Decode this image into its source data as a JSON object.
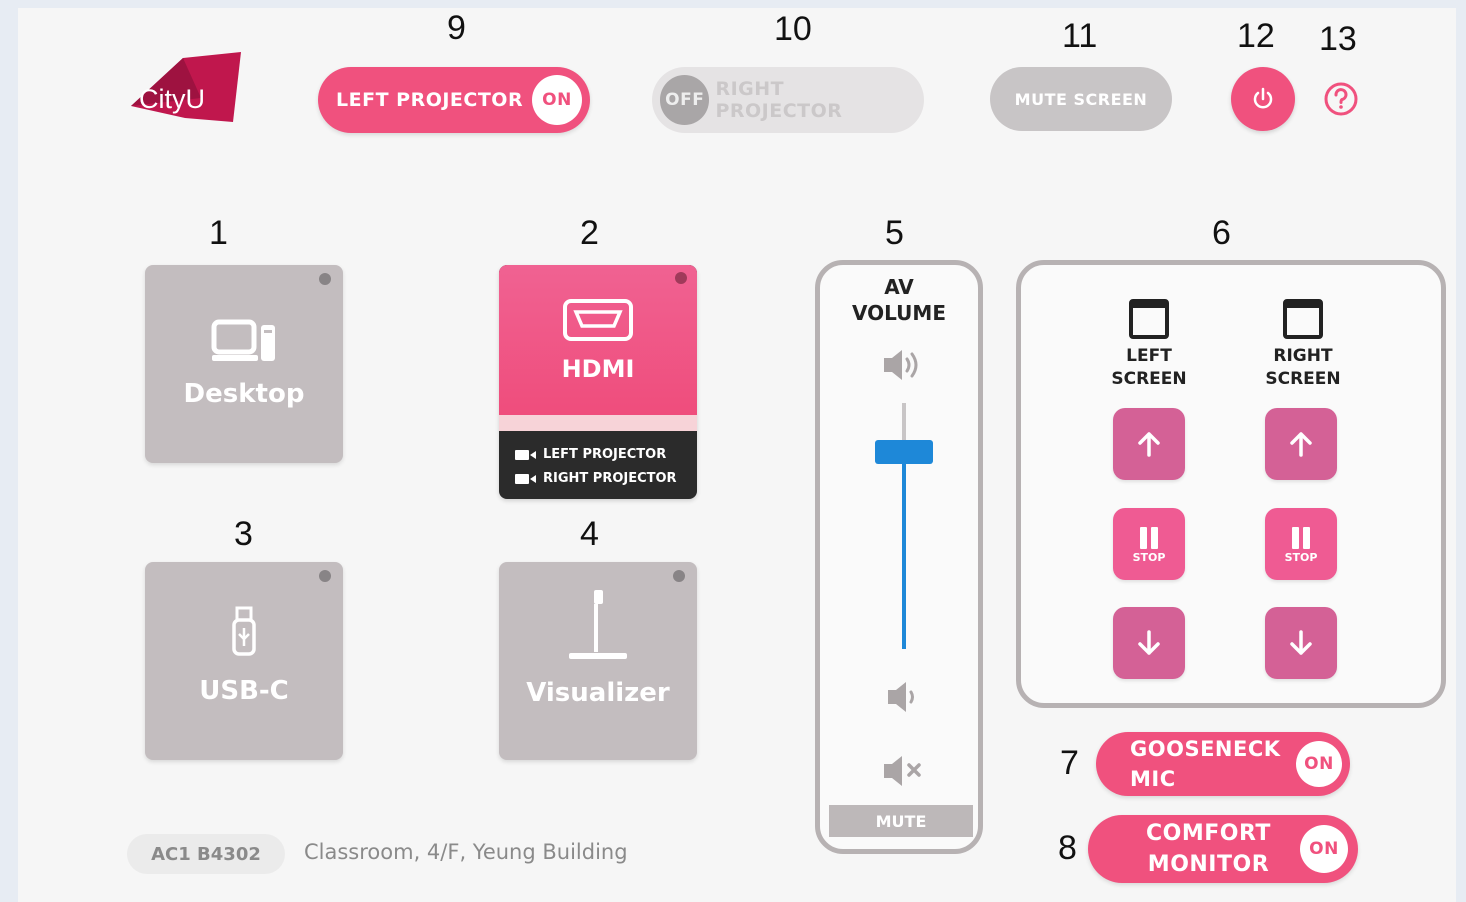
{
  "callouts": {
    "n1": "1",
    "n2": "2",
    "n3": "3",
    "n4": "4",
    "n5": "5",
    "n6": "6",
    "n7": "7",
    "n8": "8",
    "n9": "9",
    "n10": "10",
    "n11": "11",
    "n12": "12",
    "n13": "13"
  },
  "logo": {
    "text": "CityU",
    "color": "#c0174d"
  },
  "header": {
    "left_projector": {
      "label": "LEFT PROJECTOR",
      "state": "ON"
    },
    "right_projector": {
      "label": "RIGHT PROJECTOR",
      "state": "OFF"
    },
    "mute_screen": "MUTE SCREEN",
    "power_icon": "power-icon",
    "help_icon": "help-icon"
  },
  "sources": {
    "desktop": {
      "label": "Desktop",
      "icon": "desktop-computer-icon"
    },
    "hdmi": {
      "label": "HDMI",
      "icon": "hdmi-port-icon",
      "outputs": [
        "LEFT PROJECTOR",
        "RIGHT PROJECTOR"
      ]
    },
    "usbc": {
      "label": "USB-C",
      "icon": "usb-drive-icon"
    },
    "visualizer": {
      "label": "Visualizer",
      "icon": "visualizer-icon"
    }
  },
  "volume": {
    "title_line1": "AV",
    "title_line2": "VOLUME",
    "level": 0.8,
    "mute_label": "MUTE"
  },
  "screens": {
    "left": {
      "line1": "LEFT",
      "line2": "SCREEN",
      "stop_label": "STOP"
    },
    "right": {
      "line1": "RIGHT",
      "line2": "SCREEN",
      "stop_label": "STOP"
    }
  },
  "toggles": {
    "gooseneck": {
      "line1": "GOOSENECK",
      "line2": "MIC",
      "state": "ON"
    },
    "comfort": {
      "line1": "COMFORT",
      "line2": "MONITOR",
      "state": "ON"
    }
  },
  "room": {
    "code": "AC1 B4302",
    "description": "Classroom, 4/F, Yeung Building"
  },
  "colors": {
    "accent": "#f0517e",
    "grey": "#c8c5c6",
    "screen_button": "#d46196"
  }
}
